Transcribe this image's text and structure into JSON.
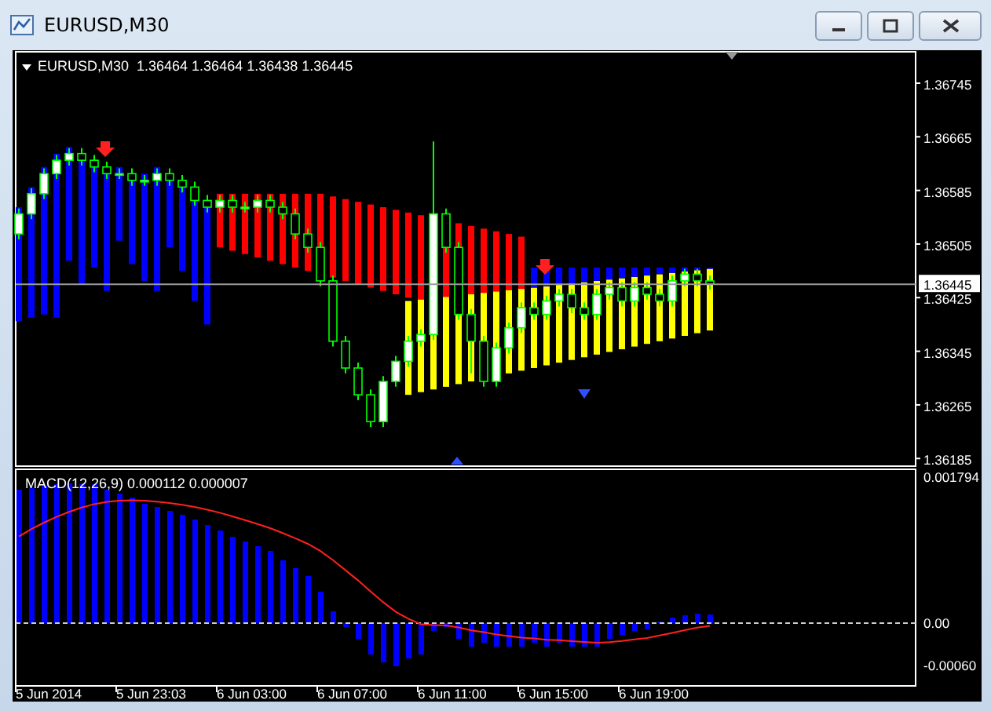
{
  "window": {
    "title": "EURUSD,M30"
  },
  "price_chart": {
    "legend": "EURUSD,M30  1.36464 1.36464 1.36438 1.36445",
    "price_ticks": [
      "1.36745",
      "1.36665",
      "1.36585",
      "1.36505",
      "1.36425",
      "1.36345",
      "1.36265",
      "1.36185"
    ],
    "current_price": "1.36445"
  },
  "macd_panel": {
    "legend": "MACD(12,26,9) 0.000112 0.000007",
    "ticks": [
      "0.001794",
      "0.00",
      "-0.00060"
    ]
  },
  "time_axis": {
    "labels": [
      "5 Jun 2014",
      "5 Jun 23:03",
      "6 Jun 03:00",
      "6 Jun 07:00",
      "6 Jun 11:00",
      "6 Jun 15:00",
      "6 Jun 19:00"
    ]
  }
}
